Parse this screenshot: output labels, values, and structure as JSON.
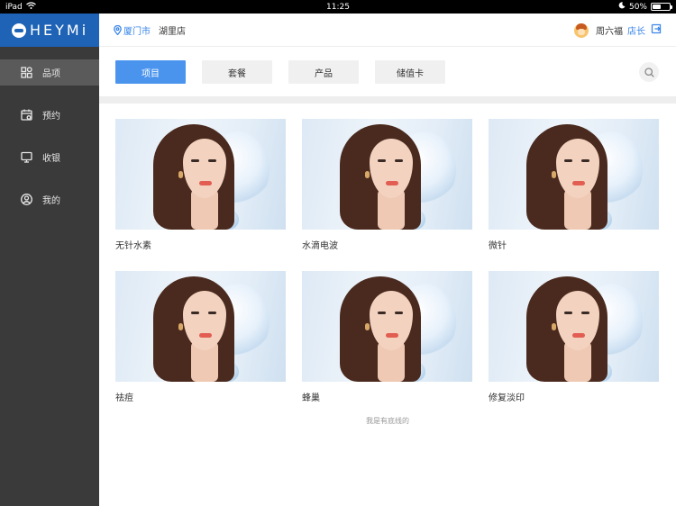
{
  "status_bar": {
    "device": "iPad",
    "time": "11:25",
    "battery": "50%",
    "battery_level": 0.5
  },
  "brand": {
    "logo_text": "HEYMi",
    "color": "#1e63b5"
  },
  "sidebar": {
    "items": [
      {
        "label": "品项",
        "icon": "grid-icon",
        "active": true
      },
      {
        "label": "预约",
        "icon": "calendar-icon",
        "active": false
      },
      {
        "label": "收银",
        "icon": "monitor-icon",
        "active": false
      },
      {
        "label": "我的",
        "icon": "user-icon",
        "active": false
      }
    ]
  },
  "header": {
    "city": "厦门市",
    "store": "湖里店",
    "user_name": "周六福",
    "user_role": "店长"
  },
  "tabs": [
    {
      "label": "项目",
      "active": true
    },
    {
      "label": "套餐",
      "active": false
    },
    {
      "label": "产品",
      "active": false
    },
    {
      "label": "储值卡",
      "active": false
    }
  ],
  "items": [
    {
      "title": "无针水素"
    },
    {
      "title": "水滴电波"
    },
    {
      "title": "微针"
    },
    {
      "title": "祛痘"
    },
    {
      "title": "蜂巢"
    },
    {
      "title": "修复淡印"
    }
  ],
  "footer_note": "我是有底线的",
  "colors": {
    "accent": "#4a94ee",
    "link": "#3a86e8",
    "sidebar_bg": "#3a3a3a"
  }
}
